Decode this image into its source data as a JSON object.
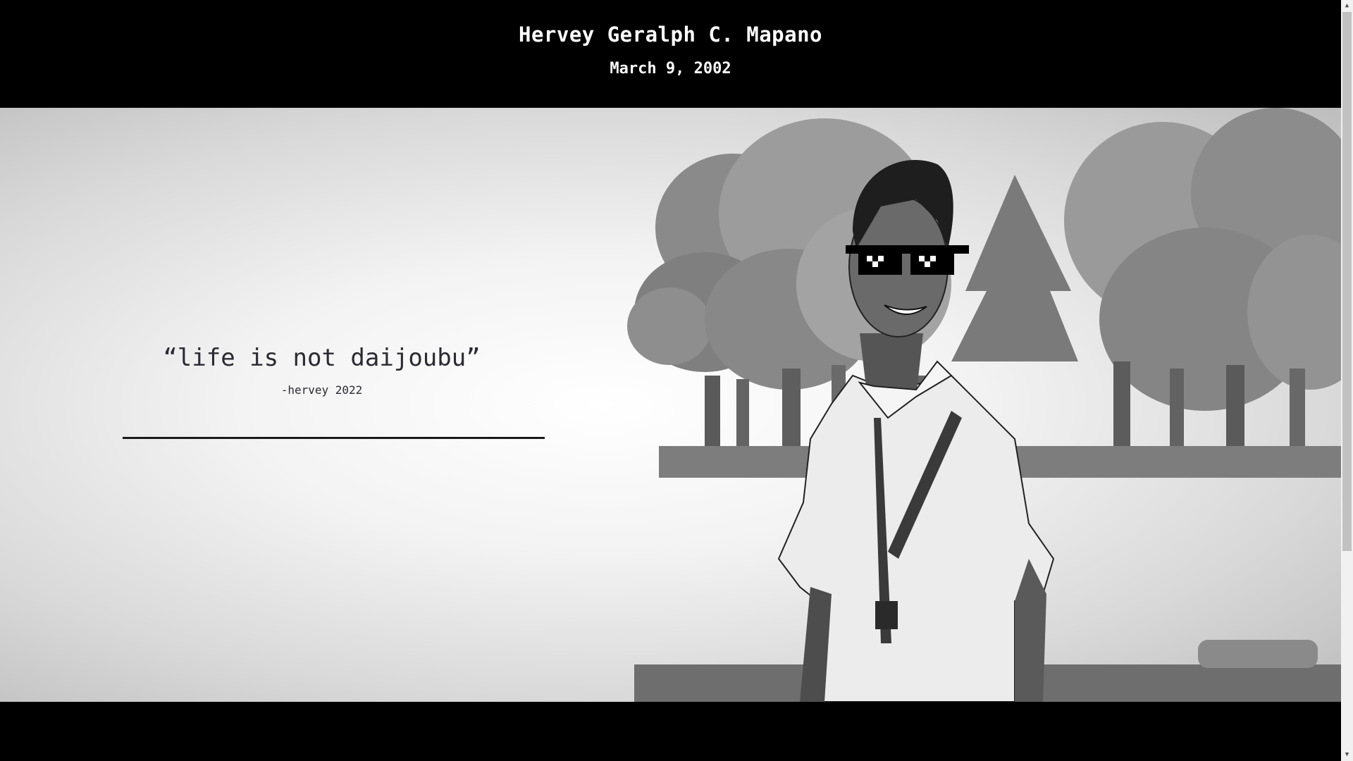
{
  "header": {
    "name": "Hervey Geralph C. Mapano",
    "birthdate": "March 9, 2002"
  },
  "hero": {
    "quote": "“life is not daijoubu”",
    "attribution": "-hervey 2022",
    "illustration_icon": "pixel-art-portrait-with-trees"
  },
  "scrollbar": {
    "up_icon": "triangle-up-icon",
    "down_icon": "triangle-down-icon"
  },
  "colors": {
    "background": "#000000",
    "header_text": "#ffffff",
    "quote_text": "#2a2a32"
  }
}
